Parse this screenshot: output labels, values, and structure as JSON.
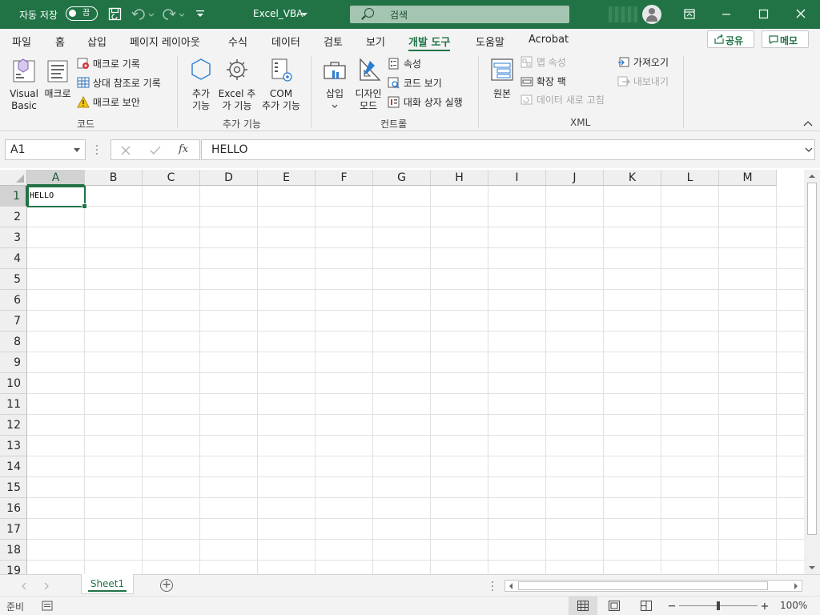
{
  "titlebar": {
    "autosave_label": "자동 저장",
    "autosave_state": "끔",
    "filename": "Excel_VBA",
    "search_placeholder": "검색"
  },
  "menu": {
    "tabs": [
      "파일",
      "홈",
      "삽입",
      "페이지 레이아웃",
      "수식",
      "데이터",
      "검토",
      "보기",
      "개발 도구",
      "도움말",
      "Acrobat"
    ],
    "active_tab": "개발 도구",
    "share_label": "공유",
    "memo_label": "메모"
  },
  "ribbon": {
    "code": {
      "group_label": "코드",
      "visual_basic": [
        "Visual",
        "Basic"
      ],
      "macro": "매크로",
      "record_macro": "매크로 기록",
      "relative_ref": "상대 참조로 기록",
      "macro_security": "매크로 보안"
    },
    "addins": {
      "group_label": "추가 기능",
      "addins": [
        "추가",
        "기능"
      ],
      "excel_addins": [
        "Excel 추",
        "가 기능"
      ],
      "com_addins": [
        "COM",
        "추가 기능"
      ]
    },
    "controls": {
      "group_label": "컨트롤",
      "insert": "삽입",
      "design_mode": [
        "디자인",
        "모드"
      ],
      "properties": "속성",
      "view_code": "코드 보기",
      "run_dialog": "대화 상자 실행"
    },
    "xml": {
      "group_label": "XML",
      "source": "원본",
      "map_properties": "맵 속성",
      "expansion_packs": "확장 팩",
      "refresh_data": "데이터 새로 고침",
      "import": "가져오기",
      "export": "내보내기"
    }
  },
  "formula_bar": {
    "name_box": "A1",
    "fx": "fx",
    "content": "HELLO"
  },
  "grid": {
    "columns": [
      "A",
      "B",
      "C",
      "D",
      "E",
      "F",
      "G",
      "H",
      "I",
      "J",
      "K",
      "L",
      "M"
    ],
    "rows": [
      "1",
      "2",
      "3",
      "4",
      "5",
      "6",
      "7",
      "8",
      "9",
      "10",
      "11",
      "12",
      "13",
      "14",
      "15",
      "16",
      "17",
      "18",
      "19"
    ],
    "selected_cell": "A1",
    "cell_a1": "HELLO"
  },
  "sheets": {
    "tabs": [
      "Sheet1"
    ],
    "active": "Sheet1"
  },
  "status": {
    "ready": "준비",
    "zoom": "100%"
  },
  "colors": {
    "accent": "#217346",
    "ribbon_bg": "#f3f3f3",
    "search_bg": "#a3c5b1"
  }
}
